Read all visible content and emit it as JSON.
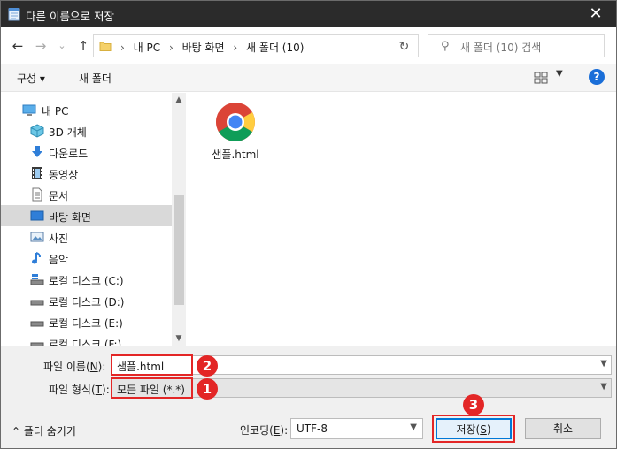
{
  "window": {
    "title": "다른 이름으로 저장",
    "close_glyph": "✕"
  },
  "nav": {
    "back_glyph": "←",
    "forward_glyph": "→",
    "recent_glyph": "⌄",
    "up_glyph": "↑",
    "breadcrumb": [
      "내 PC",
      "바탕 화면",
      "새 폴더 (10)"
    ],
    "breadcrumb_sep": "›",
    "refresh_glyph": "↻",
    "search_placeholder": "새 폴더 (10) 검색"
  },
  "toolbar": {
    "organize_label": "구성 ▾",
    "new_folder_label": "새 폴더",
    "help_label": "?"
  },
  "tree": {
    "root": "내 PC",
    "items": [
      "3D 개체",
      "다운로드",
      "동영상",
      "문서",
      "바탕 화면",
      "사진",
      "음악",
      "로컬 디스크 (C:)",
      "로컬 디스크 (D:)",
      "로컬 디스크 (E:)",
      "로컬 디스크 (F:)"
    ],
    "selected": "바탕 화면"
  },
  "files": [
    {
      "name": "샘플.html",
      "icon": "chrome-icon"
    }
  ],
  "form": {
    "filename_label_pre": "파일 이름(",
    "filename_label_key": "N",
    "filename_label_post": "):",
    "filename_value": "샘플.html",
    "filetype_label_pre": "파일 형식(",
    "filetype_label_key": "T",
    "filetype_label_post": "):",
    "filetype_value": "모든 파일 (*.*)",
    "hide_folders": "⌃  폴더 숨기기",
    "encoding_label_pre": "인코딩(",
    "encoding_label_key": "E",
    "encoding_label_post": "):",
    "encoding_value": "UTF-8",
    "save_pre": "저장(",
    "save_key": "S",
    "save_post": ")",
    "cancel": "취소"
  },
  "badges": {
    "one": "1",
    "two": "2",
    "three": "3"
  },
  "colors": {
    "highlight": "#e32626",
    "accent": "#0078d7",
    "titlebar": "#2b2b2b"
  }
}
